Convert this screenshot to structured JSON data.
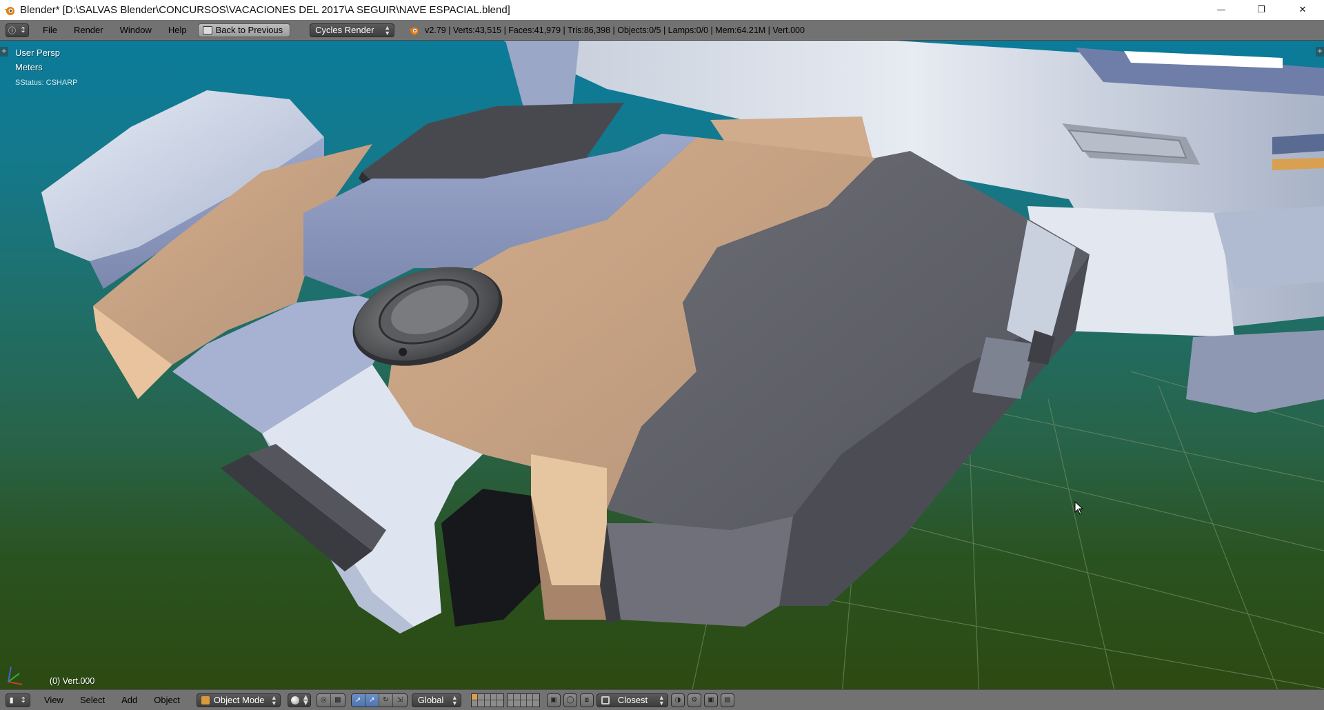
{
  "window": {
    "title": "Blender* [D:\\SALVAS Blender\\CONCURSOS\\VACACIONES DEL 2017\\A SEGUIR\\NAVE ESPACIAL.blend]",
    "minimize_glyph": "—",
    "maximize_glyph": "❐",
    "close_glyph": "✕"
  },
  "info_header": {
    "menus": [
      "File",
      "Render",
      "Window",
      "Help"
    ],
    "back_button": "Back to Previous",
    "render_engine": "Cycles Render",
    "stats": "v2.79 | Verts:43,515 | Faces:41,979 | Tris:86,398 | Objects:0/5 | Lamps:0/0 | Mem:64.21M | Vert.000"
  },
  "viewport": {
    "view_name": "User Persp",
    "units": "Meters",
    "status": "SStatus: CSHARP",
    "active_object": "(0) Vert.000",
    "colors": {
      "sky_top": "#0b7b9a",
      "ground": "#2c4a12",
      "hull_light": "#c7cfe0",
      "hull_blue": "#8d9ac0",
      "hull_tan": "#c6a283",
      "hull_dark": "#5d5e66"
    }
  },
  "view3d_header": {
    "menus": [
      "View",
      "Select",
      "Add",
      "Object"
    ],
    "mode": "Object Mode",
    "orientation": "Global",
    "snap_target": "Closest"
  },
  "icons": {
    "app": "blender-logo-icon",
    "editor_type": "info-editor-icon",
    "view3d_editor": "3d-view-editor-icon",
    "cursor": "mouse-pointer-icon"
  }
}
